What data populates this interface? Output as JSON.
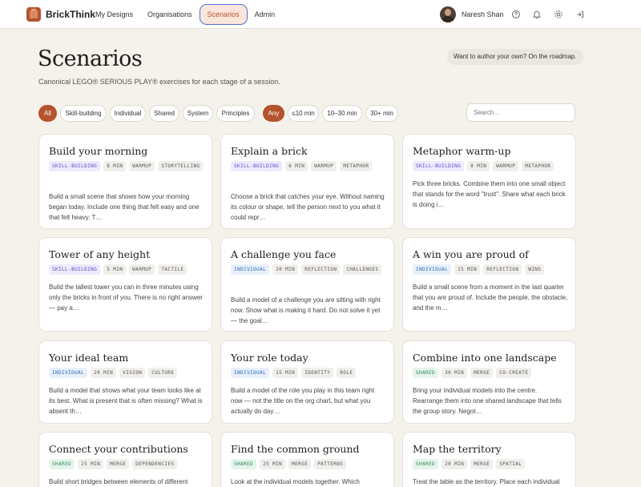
{
  "app": {
    "name": "BrickThink"
  },
  "nav": [
    {
      "label": "My Designs",
      "active": false
    },
    {
      "label": "Organisations",
      "active": false
    },
    {
      "label": "Scenarios",
      "active": true
    },
    {
      "label": "Admin",
      "active": false
    }
  ],
  "user": {
    "name": "Naresh Shan"
  },
  "header": {
    "title": "Scenarios",
    "subtitle": "Canonical LEGO® SERIOUS PLAY® exercises for each stage of a session.",
    "roadmap_note": "Want to author your own? On the roadmap."
  },
  "filters": {
    "category": [
      "All",
      "Skill-building",
      "Individual",
      "Shared",
      "System",
      "Principles"
    ],
    "category_selected": "All",
    "duration": [
      "Any",
      "≤10 min",
      "10–30 min",
      "30+ min"
    ],
    "duration_selected": "Any"
  },
  "search": {
    "placeholder": "Search…",
    "value": ""
  },
  "colors": {
    "accent": "#b5532f",
    "skill": "#5b4bc8",
    "individual": "#2f6bb8",
    "shared": "#2e8b57"
  },
  "cards": [
    {
      "title": "Build your morning",
      "tags": [
        {
          "text": "SKILL-BUILDING",
          "kind": "skill"
        },
        {
          "text": "8 MIN",
          "kind": "plain"
        },
        {
          "text": "WARMUP",
          "kind": "plain"
        },
        {
          "text": "STORYTELLING",
          "kind": "plain"
        }
      ],
      "desc": "Build a small scene that shows how your morning began today. Include one thing that felt easy and one that felt heavy. T…"
    },
    {
      "title": "Explain a brick",
      "tags": [
        {
          "text": "SKILL-BUILDING",
          "kind": "skill"
        },
        {
          "text": "6 MIN",
          "kind": "plain"
        },
        {
          "text": "WARMUP",
          "kind": "plain"
        },
        {
          "text": "METAPHOR",
          "kind": "plain"
        }
      ],
      "desc": "Choose a brick that catches your eye. Without naming its colour or shape, tell the person next to you what it could repr…"
    },
    {
      "title": "Metaphor warm-up",
      "tags": [
        {
          "text": "SKILL-BUILDING",
          "kind": "skill"
        },
        {
          "text": "8 MIN",
          "kind": "plain"
        },
        {
          "text": "WARMUP",
          "kind": "plain"
        },
        {
          "text": "METAPHOR",
          "kind": "plain"
        }
      ],
      "desc": "Pick three bricks. Combine them into one small object that stands for the word \"trust\". Share what each brick is doing i…"
    },
    {
      "title": "Tower of any height",
      "tags": [
        {
          "text": "SKILL-BUILDING",
          "kind": "skill"
        },
        {
          "text": "5 MIN",
          "kind": "plain"
        },
        {
          "text": "WARMUP",
          "kind": "plain"
        },
        {
          "text": "TACTILE",
          "kind": "plain"
        }
      ],
      "desc": "Build the tallest tower you can in three minutes using only the bricks in front of you. There is no right answer — pay a…"
    },
    {
      "title": "A challenge you face",
      "tags": [
        {
          "text": "INDIVIDUAL",
          "kind": "indiv"
        },
        {
          "text": "20 MIN",
          "kind": "plain"
        },
        {
          "text": "REFLECTION",
          "kind": "plain"
        },
        {
          "text": "CHALLENGES",
          "kind": "plain"
        }
      ],
      "desc": "Build a model of a challenge you are sitting with right now. Show what is making it hard. Do not solve it yet — the goal…"
    },
    {
      "title": "A win you are proud of",
      "tags": [
        {
          "text": "INDIVIDUAL",
          "kind": "indiv"
        },
        {
          "text": "15 MIN",
          "kind": "plain"
        },
        {
          "text": "REFLECTION",
          "kind": "plain"
        },
        {
          "text": "WINS",
          "kind": "plain"
        }
      ],
      "desc": "Build a small scene from a moment in the last quarter that you are proud of. Include the people, the obstacle, and the m…"
    },
    {
      "title": "Your ideal team",
      "tags": [
        {
          "text": "INDIVIDUAL",
          "kind": "indiv"
        },
        {
          "text": "20 MIN",
          "kind": "plain"
        },
        {
          "text": "VISION",
          "kind": "plain"
        },
        {
          "text": "CULTURE",
          "kind": "plain"
        }
      ],
      "desc": "Build a model that shows what your team looks like at its best. What is present that is often missing? What is absent th…"
    },
    {
      "title": "Your role today",
      "tags": [
        {
          "text": "INDIVIDUAL",
          "kind": "indiv"
        },
        {
          "text": "15 MIN",
          "kind": "plain"
        },
        {
          "text": "IDENTITY",
          "kind": "plain"
        },
        {
          "text": "ROLE",
          "kind": "plain"
        }
      ],
      "desc": "Build a model of the role you play in this team right now — not the title on the org chart, but what you actually do day…"
    },
    {
      "title": "Combine into one landscape",
      "tags": [
        {
          "text": "SHARED",
          "kind": "shared"
        },
        {
          "text": "30 MIN",
          "kind": "plain"
        },
        {
          "text": "MERGE",
          "kind": "plain"
        },
        {
          "text": "CO-CREATE",
          "kind": "plain"
        }
      ],
      "desc": "Bring your individual models into the centre. Rearrange them into one shared landscape that tells the group story. Negot…"
    },
    {
      "title": "Connect your contributions",
      "tags": [
        {
          "text": "SHARED",
          "kind": "shared"
        },
        {
          "text": "25 MIN",
          "kind": "plain"
        },
        {
          "text": "MERGE",
          "kind": "plain"
        },
        {
          "text": "DEPENDENCIES",
          "kind": "plain"
        }
      ],
      "desc": "Build short bridges between elements of different"
    },
    {
      "title": "Find the common ground",
      "tags": [
        {
          "text": "SHARED",
          "kind": "shared"
        },
        {
          "text": "25 MIN",
          "kind": "plain"
        },
        {
          "text": "MERGE",
          "kind": "plain"
        },
        {
          "text": "PATTERNS",
          "kind": "plain"
        }
      ],
      "desc": "Look at the individual models together. Which"
    },
    {
      "title": "Map the territory",
      "tags": [
        {
          "text": "SHARED",
          "kind": "shared"
        },
        {
          "text": "20 MIN",
          "kind": "plain"
        },
        {
          "text": "MERGE",
          "kind": "plain"
        },
        {
          "text": "SPATIAL",
          "kind": "plain"
        }
      ],
      "desc": "Treat the table as the territory. Place each individual"
    }
  ]
}
